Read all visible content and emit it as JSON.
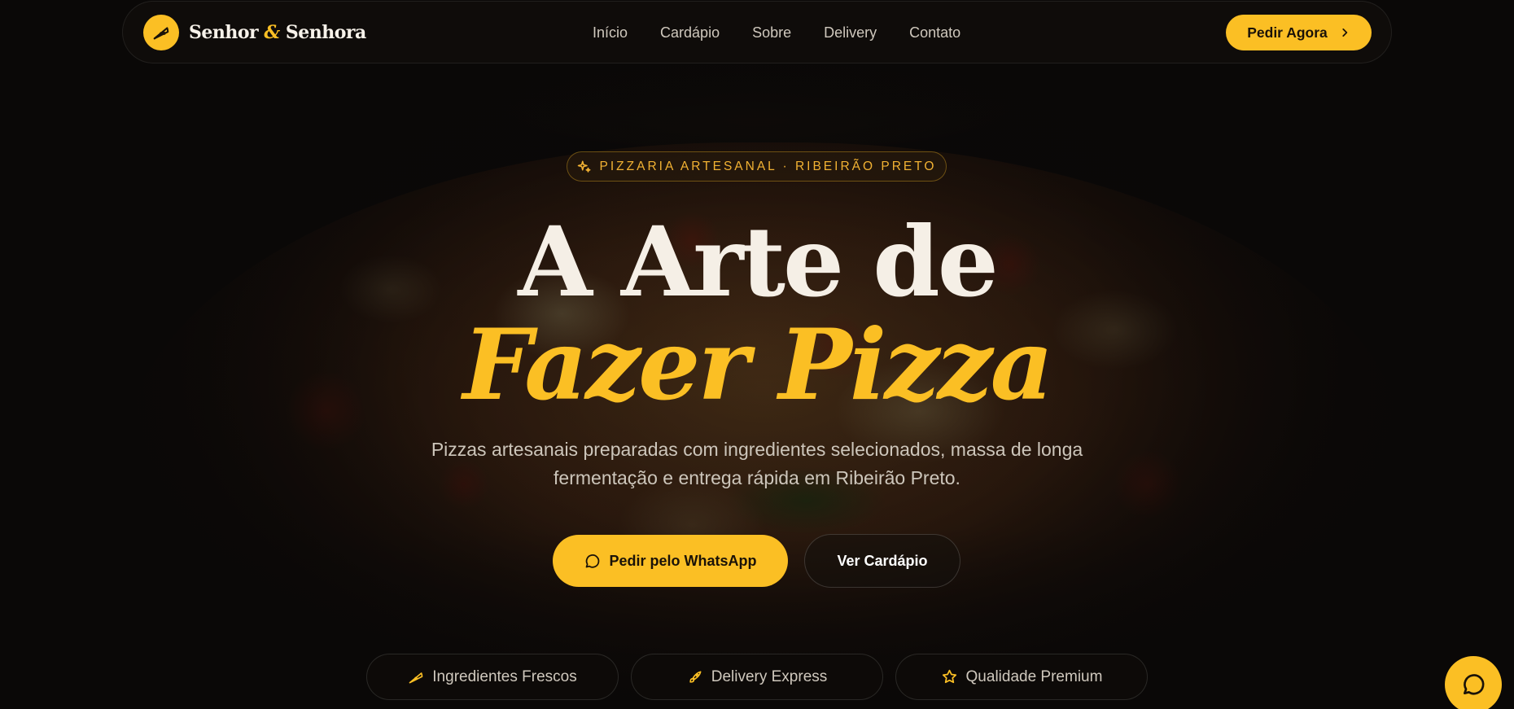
{
  "brand": {
    "name_part1": "Senhor",
    "ampersand": "&",
    "name_part2": "Senhora",
    "logo_icon": "pizza-slice-icon"
  },
  "nav": {
    "links": [
      {
        "label": "Início"
      },
      {
        "label": "Cardápio"
      },
      {
        "label": "Sobre"
      },
      {
        "label": "Delivery"
      },
      {
        "label": "Contato"
      }
    ],
    "order_button": {
      "label": "Pedir Agora",
      "icon": "chevron-right-icon"
    }
  },
  "hero": {
    "badge": {
      "text": "PIZZARIA ARTESANAL · RIBEIRÃO PRETO",
      "icon": "sparkles-icon"
    },
    "headline_line1": "A Arte de",
    "headline_line2": "Fazer Pizza",
    "subtitle_line1": "Pizzas artesanais preparadas com ingredientes selecionados, massa de longa",
    "subtitle_line2": "fermentação e entrega rápida em Ribeirão Preto.",
    "primary_cta": {
      "label": "Pedir pelo WhatsApp",
      "icon": "message-circle-icon"
    },
    "secondary_cta": {
      "label": "Ver Cardápio"
    }
  },
  "features": [
    {
      "label": "Ingredientes Frescos",
      "icon": "pizza-slice-icon"
    },
    {
      "label": "Delivery Express",
      "icon": "rocket-icon"
    },
    {
      "label": "Qualidade Premium",
      "icon": "star-icon"
    }
  ],
  "chat_button": {
    "icon": "message-circle-icon"
  },
  "colors": {
    "accent": "#fbbf24",
    "background": "#0b0908",
    "text_primary": "#f5efe6",
    "text_muted": "#cfc8bd"
  }
}
